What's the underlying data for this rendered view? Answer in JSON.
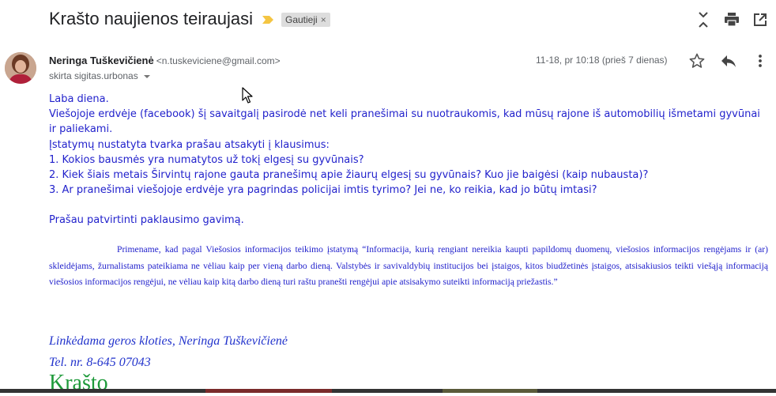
{
  "subject": "Krašto naujienos teiraujasi",
  "label": "Gautieji",
  "label_close": "×",
  "sender": {
    "name": "Neringa Tuškevičienė",
    "email": "<n.tuskeviciene@gmail.com>",
    "to": "skirta sigitas.urbonas",
    "date": "11-18, pr 10:18 (prieš 7 dienas)"
  },
  "body": {
    "greeting": "Laba diena.",
    "line1": "Viešojoje erdvėje (facebook) šį savaitgalį pasirodė net keli pranešimai su nuotraukomis, kad mūsų rajone iš automobilių išmetami gyvūnai ir paliekami.",
    "line2": "Įstatymų nustatyta tvarka prašau atsakyti į klausimus:",
    "q1": "1. Kokios bausmės yra numatytos už tokį elgesį su gyvūnais?",
    "q2": "2. Kiek šiais metais Širvintų rajone gauta pranešimų apie žiaurų elgesį su gyvūnais? Kuo jie baigėsi (kaip nubausta)?",
    "q3": "3. Ar pranešimai viešojoje erdvėje yra pagrindas policijai imtis tyrimo? Jei ne, ko reikia, kad jo būtų imtasi?",
    "confirm": "Prašau patvirtinti paklausimo gavimą.",
    "quote": "Primename, kad pagal Viešosios informacijos teikimo įstatymą “Informacija, kurią rengiant nereikia kaupti papildomų duomenų, viešosios informacijos rengėjams ir (ar) skleidėjams, žurnalistams pateikiama ne vėliau kaip per vieną darbo dieną. Valstybės ir savivaldybių institucijos bei įstaigos, kitos biudžetinės įstaigos, atsisakiusios teikti viešąją informaciją viešosios informacijos rengėjui, ne vėliau kaip kitą darbo dieną turi raštu pranešti rengėjui apie atsisakymo suteikti informaciją priežastis.”"
  },
  "signature": {
    "line1": "Linkėdama geros kloties, Neringa Tuškevičienė",
    "line2": "Tel. nr. 8-645 07043",
    "logo": "Krašto"
  },
  "colors": {
    "body_text": "#2222cc",
    "logo_green": "#1e9a3a",
    "importance_marker": "#f4c542"
  },
  "icons": [
    "importance-marker-icon",
    "expand-all-icon",
    "print-icon",
    "open-in-new-window-icon",
    "star-icon",
    "reply-icon",
    "more-vert-icon",
    "cursor-icon"
  ]
}
